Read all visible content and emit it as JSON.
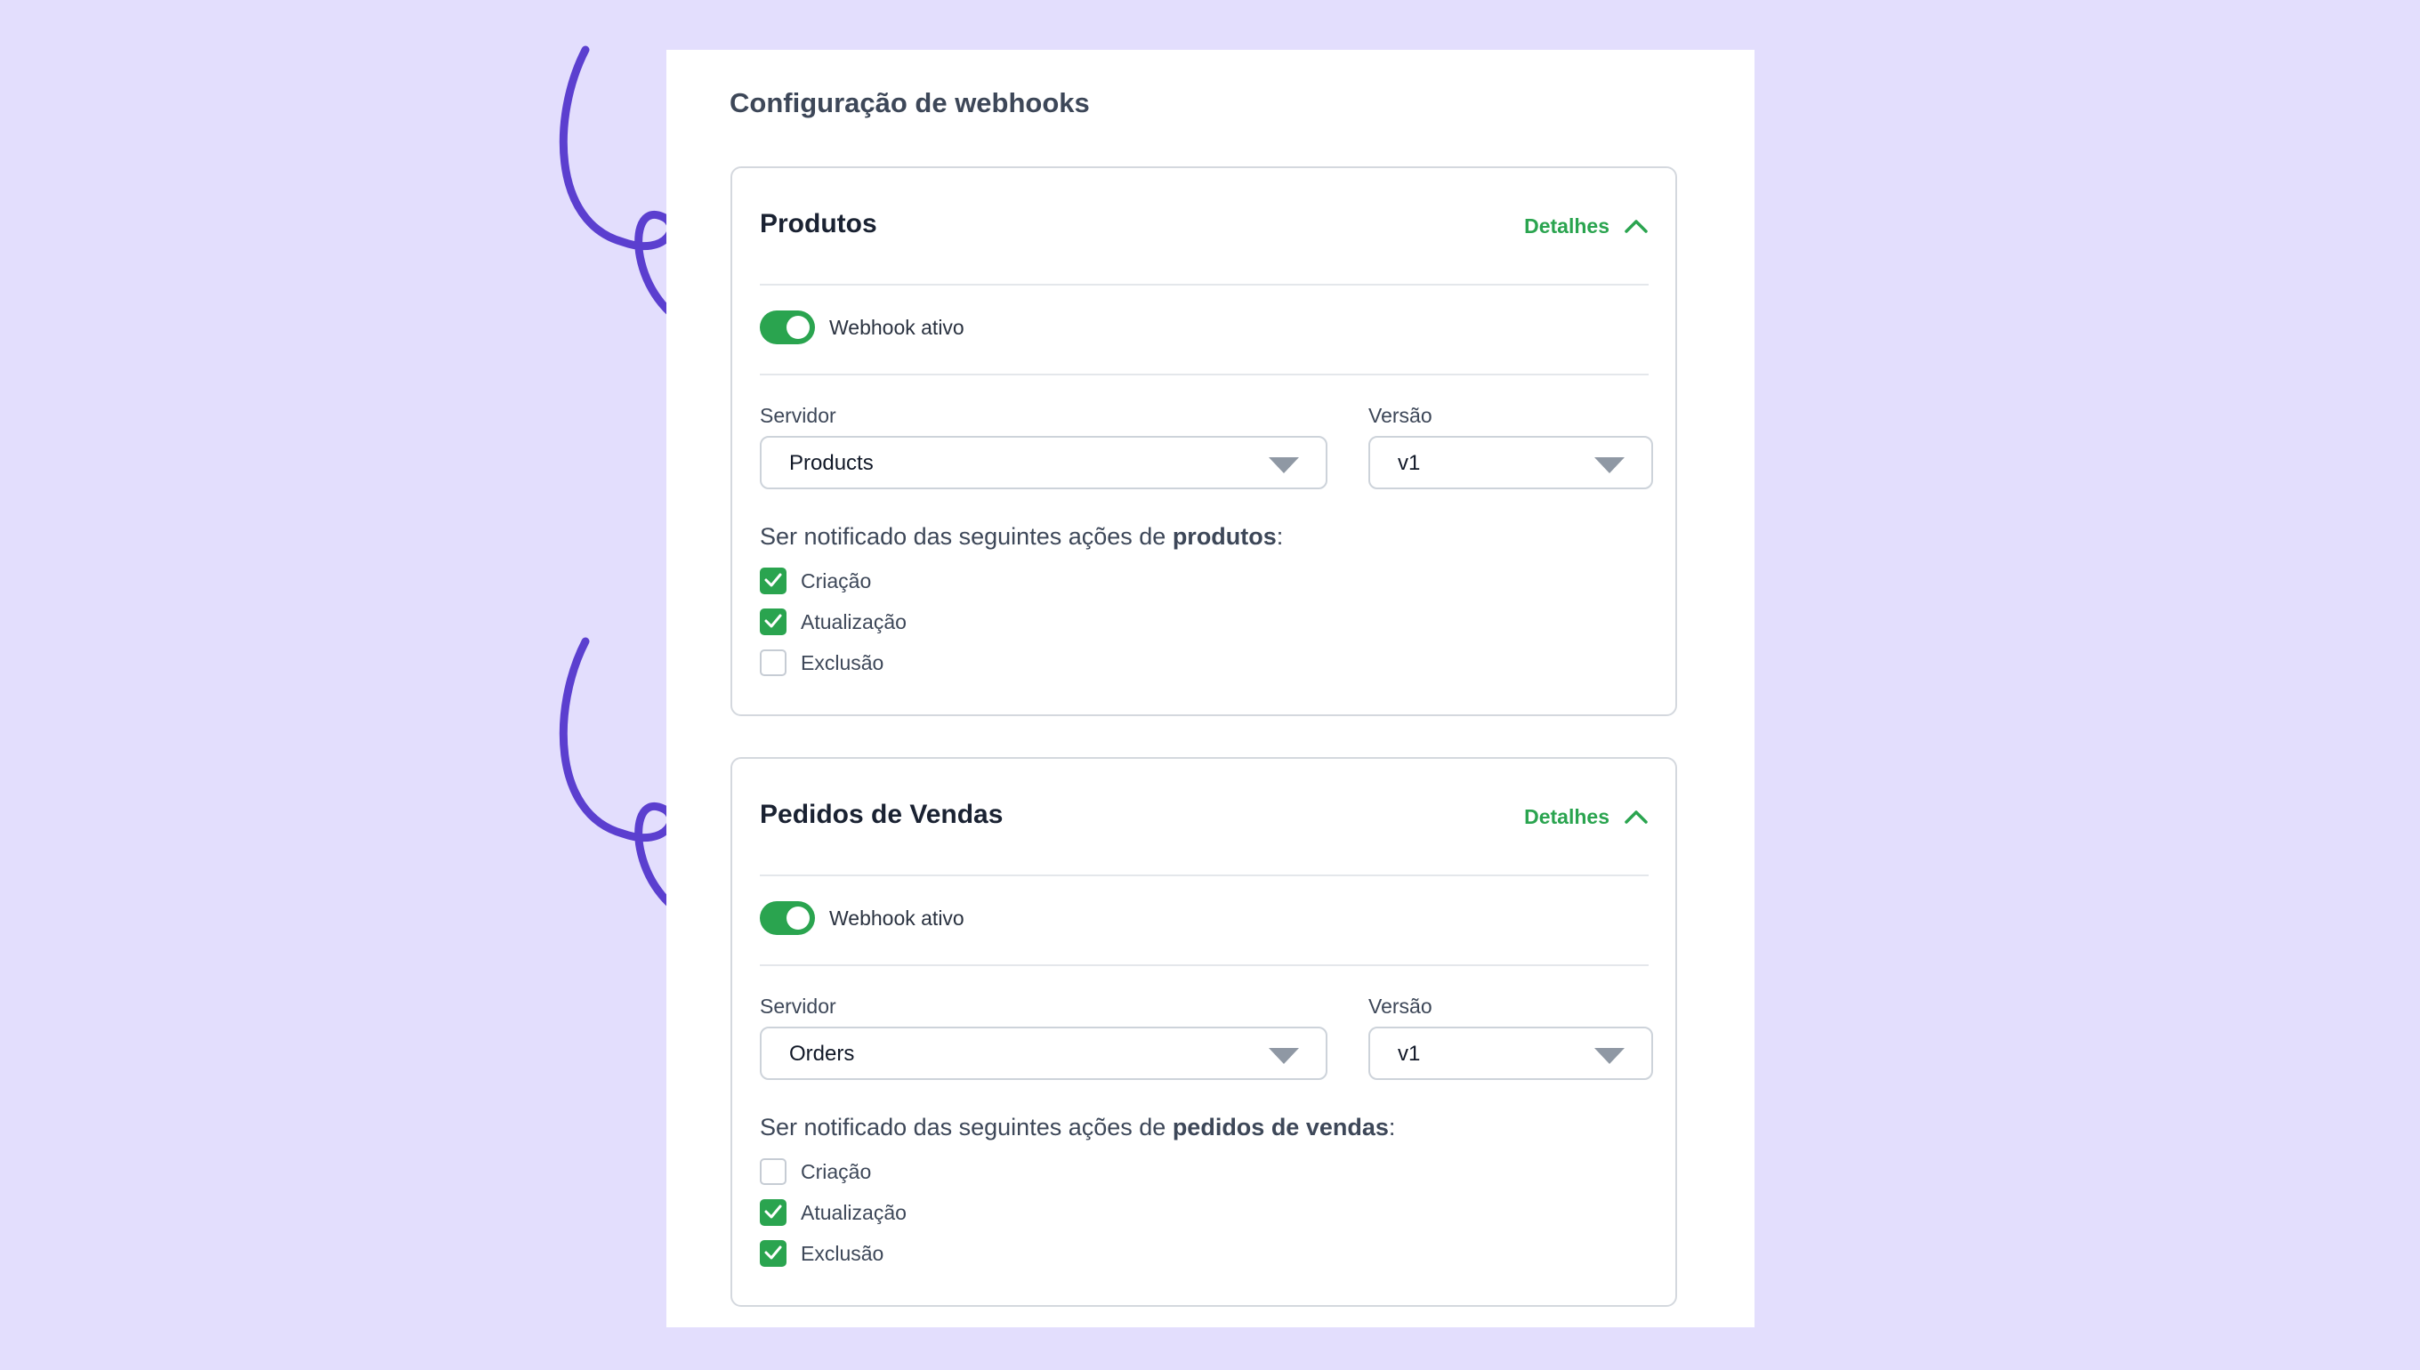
{
  "page": {
    "title": "Configuração de webhooks"
  },
  "colors": {
    "background": "#e3defd",
    "accent_green": "#2aa44f",
    "arrow_purple": "#5b3fcf"
  },
  "cards": [
    {
      "title": "Produtos",
      "details_label": "Detalhes",
      "details_icon": "chevron-up-icon",
      "toggle_label": "Webhook ativo",
      "toggle_on": true,
      "server_label": "Servidor",
      "server_value": "Products",
      "version_label": "Versão",
      "version_value": "v1",
      "notify_prefix": "Ser notificado das seguintes ações de ",
      "notify_entity": "produtos",
      "notify_suffix": ":",
      "actions": [
        {
          "label": "Criação",
          "checked": true
        },
        {
          "label": "Atualização",
          "checked": true
        },
        {
          "label": "Exclusão",
          "checked": false
        }
      ]
    },
    {
      "title": "Pedidos de Vendas",
      "details_label": "Detalhes",
      "details_icon": "chevron-up-icon",
      "toggle_label": "Webhook ativo",
      "toggle_on": true,
      "server_label": "Servidor",
      "server_value": "Orders",
      "version_label": "Versão",
      "version_value": "v1",
      "notify_prefix": "Ser notificado das seguintes ações de ",
      "notify_entity": "pedidos de vendas",
      "notify_suffix": ":",
      "actions": [
        {
          "label": "Criação",
          "checked": false
        },
        {
          "label": "Atualização",
          "checked": true
        },
        {
          "label": "Exclusão",
          "checked": true
        }
      ]
    }
  ]
}
